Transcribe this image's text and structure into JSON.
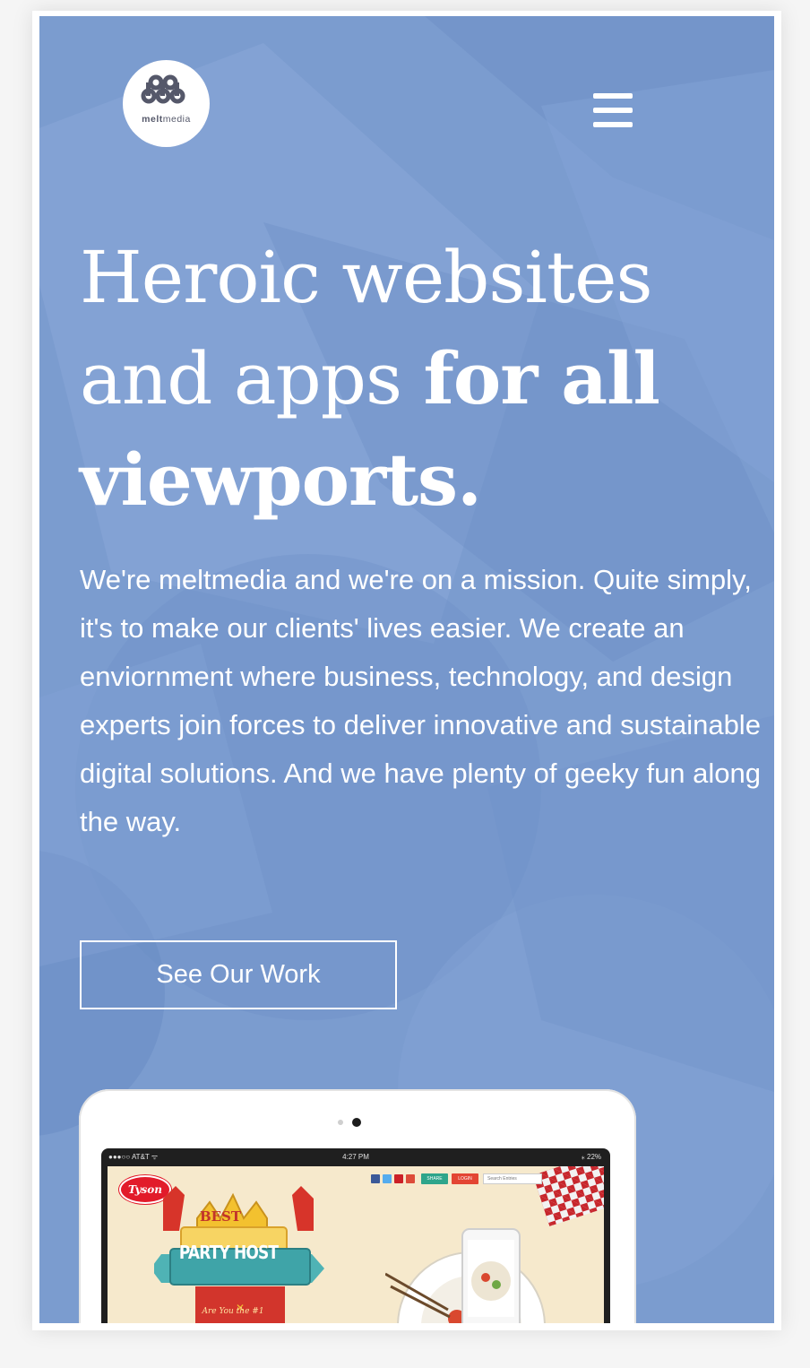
{
  "brand": {
    "logo_label_bold": "melt",
    "logo_label_light": "media"
  },
  "hero": {
    "headline_regular": "Heroic websites and apps ",
    "headline_bold": "for all viewports.",
    "intro": "We're meltmedia and we're on a mission. Quite simply, it's to make our clients' lives easier. We create an enviornment where business, technology, and design experts join forces to deliver innovative and sustainable digital solutions. And we have plenty of geeky fun along the way.",
    "cta_label": "See Our Work"
  },
  "tablet_screen": {
    "carrier": "●●●○○ AT&T ᯤ",
    "time": "4:27 PM",
    "battery": "⁎ 22%",
    "logo_text": "Tyson",
    "share_label": "SHARE",
    "login_label": "LOGIN",
    "search_placeholder": "Search Entries",
    "badge_best": "BEST",
    "badge_host": "PARTY HOST",
    "badge_sub": "Are You the #1"
  },
  "colors": {
    "hero_background": "#7b9ccf",
    "text": "#ffffff",
    "logo_dots": "#55586a"
  },
  "icons": {
    "menu": "hamburger-menu-icon",
    "logo": "meltmedia-dots-logo"
  }
}
